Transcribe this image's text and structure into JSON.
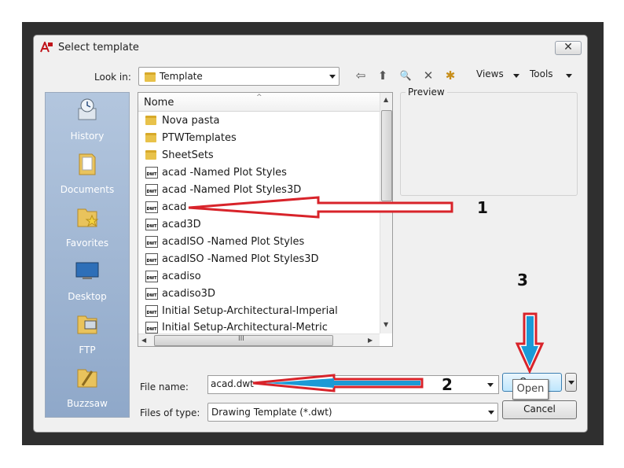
{
  "window": {
    "title": "Select template",
    "close_symbol": "✕"
  },
  "look_in": {
    "label": "Look in:",
    "value": "Template"
  },
  "toolbar": {
    "back_symbol": "⇦",
    "up_symbol": "⬆",
    "search_symbol": "🔍",
    "delete_symbol": "✕",
    "new_folder_symbol": "✱",
    "views_label": "Views",
    "tools_label": "Tools"
  },
  "places": [
    "History",
    "Documents",
    "Favorites",
    "Desktop",
    "FTP",
    "Buzzsaw"
  ],
  "file_list": {
    "column_header": "Nome",
    "items": [
      {
        "name": "Nova pasta",
        "type": "folder"
      },
      {
        "name": "PTWTemplates",
        "type": "folder"
      },
      {
        "name": "SheetSets",
        "type": "folder"
      },
      {
        "name": "acad -Named Plot Styles",
        "type": "dwt"
      },
      {
        "name": "acad -Named Plot Styles3D",
        "type": "dwt"
      },
      {
        "name": "acad",
        "type": "dwt"
      },
      {
        "name": "acad3D",
        "type": "dwt"
      },
      {
        "name": "acadISO -Named Plot Styles",
        "type": "dwt"
      },
      {
        "name": "acadISO -Named Plot Styles3D",
        "type": "dwt"
      },
      {
        "name": "acadiso",
        "type": "dwt"
      },
      {
        "name": "acadiso3D",
        "type": "dwt"
      },
      {
        "name": "Initial Setup-Architectural-Imperial",
        "type": "dwt"
      },
      {
        "name": "Initial Setup-Architectural-Metric",
        "type": "dwt"
      }
    ],
    "file_icon_text": "DWT",
    "scroll_grip": "III"
  },
  "preview": {
    "label": "Preview"
  },
  "file_name": {
    "label": "File name:",
    "value": "acad.dwt"
  },
  "files_of_type": {
    "label": "Files of type:",
    "value": "Drawing Template (*.dwt)"
  },
  "buttons": {
    "open": "Open",
    "cancel": "Cancel"
  },
  "tooltip": {
    "text": "Open"
  },
  "annotations": {
    "step1": "1",
    "step2": "2",
    "step3": "3"
  },
  "colors": {
    "arrow_red": "#d8232a",
    "arrow_blue": "#1b9ad6",
    "places_blue": "#9cb4d3"
  }
}
